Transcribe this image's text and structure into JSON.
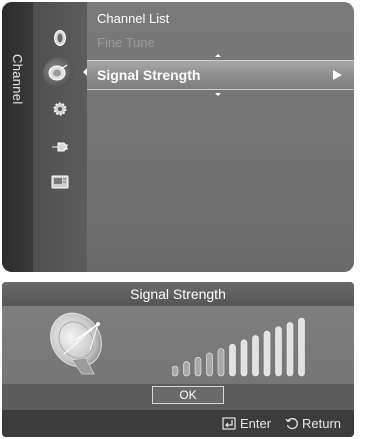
{
  "menu": {
    "category": "Channel",
    "items": [
      {
        "label": "Channel List",
        "state": "normal"
      },
      {
        "label": "Fine Tune",
        "state": "disabled"
      },
      {
        "label": "Signal Strength",
        "state": "selected"
      }
    ],
    "icons": [
      "picture-icon",
      "antenna-dish-icon",
      "setup-gear-icon",
      "input-plug-icon",
      "application-icon"
    ]
  },
  "dialog": {
    "title": "Signal Strength",
    "ok_label": "OK",
    "signal_bars_total": 12,
    "signal_bars_lit": 5,
    "footer": {
      "enter_label": "Enter",
      "return_label": "Return"
    }
  },
  "colors": {
    "panel": "#757575",
    "sidebar": "#2c2c2c",
    "selected_row": "#9a9a9a",
    "dialog": "#5c5c5c",
    "footer": "#3c3c3c"
  }
}
